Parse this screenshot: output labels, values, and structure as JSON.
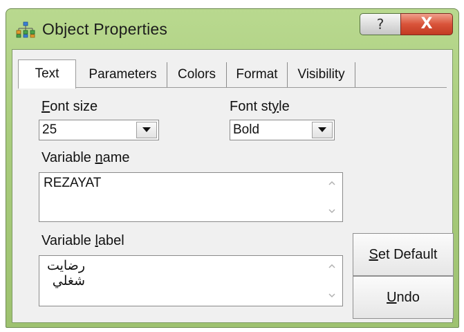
{
  "window": {
    "title": "Object Properties",
    "help_glyph": "?",
    "close_glyph": "X"
  },
  "tabs": [
    {
      "label": "Text",
      "active": true
    },
    {
      "label": "Parameters",
      "active": false
    },
    {
      "label": "Colors",
      "active": false
    },
    {
      "label": "Format",
      "active": false
    },
    {
      "label": "Visibility",
      "active": false
    }
  ],
  "text_tab": {
    "font_size": {
      "label_prefix": "",
      "label_accel": "F",
      "label_rest": "ont size",
      "value": "25"
    },
    "font_style": {
      "label_prefix": "Font st",
      "label_accel": "y",
      "label_rest": "le",
      "value": "Bold"
    },
    "variable_name": {
      "label_prefix": "Variable ",
      "label_accel": "n",
      "label_rest": "ame",
      "value": "REZAYAT"
    },
    "variable_label": {
      "label_prefix": "Variable ",
      "label_accel": "l",
      "label_rest": "abel",
      "lines": [
        "رضايت",
        "شغلي"
      ]
    }
  },
  "buttons": {
    "set_default": {
      "accel": "S",
      "rest": "et Default"
    },
    "undo": {
      "accel": "U",
      "rest": "ndo"
    }
  },
  "colors": {
    "titlebar": "#a9cc7d",
    "close_button": "#d9543a",
    "dialog_bg": "#f0f0f0"
  }
}
